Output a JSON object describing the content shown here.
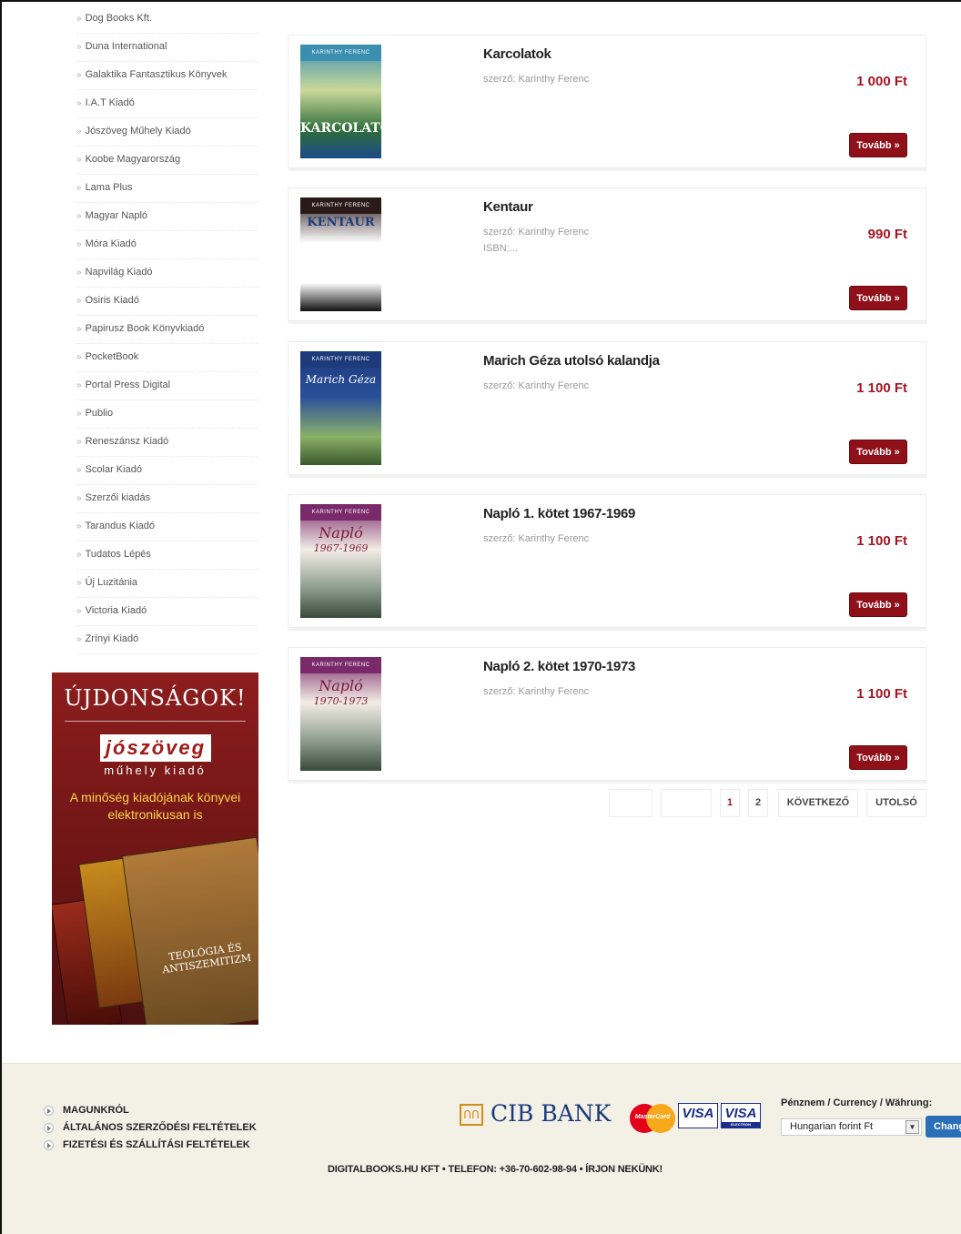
{
  "sidebar": {
    "publishers": [
      "Dog Books Kft.",
      "Duna International",
      "Galaktika Fantasztikus Könyvek",
      "I.A.T Kiadó",
      "Jószöveg Műhely Kiadó",
      "Koobe Magyarország",
      "Lama Plus",
      "Magyar Napló",
      "Móra Kiadó",
      "Napvilág Kiadó",
      "Osiris Kiadó",
      "Papirusz Book Könyvkiadó",
      "PocketBook",
      "Portal Press Digital",
      "Publio",
      "Reneszánsz Kiadó",
      "Scolar Kiadó",
      "Szerzői kiadás",
      "Tarandus Kiadó",
      "Tudatos Lépés",
      "Új Luzitánia",
      "Victoria Kiadó",
      "Zrínyi Kiadó"
    ],
    "arrow_glyph": "»"
  },
  "banner": {
    "title": "ÚJDONSÁGOK!",
    "logo": "jószöveg",
    "logo_sub": "műhely kiadó",
    "text": "A minőség kiadójának könyvei elektronikusan is",
    "book_text": "TEOLÓGIA ÉS ANTISZEMITIZM"
  },
  "products": [
    {
      "title": "Karcolatok",
      "author": "szerző: Karinthy Ferenc",
      "isbn": "",
      "price": "1 000 Ft",
      "more": "Tovább »",
      "cover_author": "KARINTHY FERENC",
      "cover_title": "KARCOLATOK",
      "cover_colors": [
        "#3a8fb0",
        "#c9d99a",
        "#2f6e3a",
        "#1c4a8a"
      ]
    },
    {
      "title": "Kentaur",
      "author": "szerző: Karinthy Ferenc",
      "isbn": "ISBN:...",
      "price": "990 Ft",
      "more": "Tovább »",
      "cover_author": "KARINTHY FERENC",
      "cover_title": "KENTAUR",
      "cover_colors": [
        "#2b1a1a",
        "#ffffff",
        "#ffffff",
        "#111111"
      ]
    },
    {
      "title": "Marich Géza utolsó kalandja",
      "author": "szerző: Karinthy Ferenc",
      "isbn": "",
      "price": "1 100 Ft",
      "more": "Tovább »",
      "cover_author": "KARINTHY FERENC",
      "cover_title": "Marich Géza",
      "cover_colors": [
        "#1d3a7a",
        "#2a4f9a",
        "#8ab06a",
        "#3a5a2a"
      ]
    },
    {
      "title": "Napló 1. kötet 1967-1969",
      "author": "szerző: Karinthy Ferenc",
      "isbn": "",
      "price": "1 100 Ft",
      "more": "Tovább »",
      "cover_author": "KARINTHY FERENC",
      "cover_title": "Napló",
      "cover_years": "1967-1969",
      "cover_colors": [
        "#7a2a6a",
        "#f3ede6",
        "#8a9a8a",
        "#3a4a3a"
      ]
    },
    {
      "title": "Napló 2. kötet 1970-1973",
      "author": "szerző: Karinthy Ferenc",
      "isbn": "",
      "price": "1 100 Ft",
      "more": "Tovább »",
      "cover_author": "KARINTHY FERENC",
      "cover_title": "Napló",
      "cover_years": "1970-1973",
      "cover_colors": [
        "#7a2a6a",
        "#f3ede6",
        "#8a9a8a",
        "#3a4a3a"
      ]
    }
  ],
  "pagination": {
    "pages": [
      "1",
      "2"
    ],
    "current": "1",
    "next": "KÖVETKEZŐ",
    "last": "UTOLSÓ"
  },
  "footer": {
    "links": [
      "MAGUNKRÓL",
      "ÁLTALÁNOS SZERZŐDÉSI FELTÉTELEK",
      "FIZETÉSI ÉS SZÁLLÍTÁSI FELTÉTELEK"
    ],
    "bank": "CIB BANK",
    "card_mastercard": "MasterCard",
    "card_visa": "VISA",
    "card_visa_electron": "VISA",
    "card_visa_electron_sub": "ELECTRON",
    "currency_label": "Pénznem / Currency / Währung:",
    "currency_value": "Hungarian forint Ft",
    "change_button": "Change",
    "contact": "DIGITALBOOKS.HU KFT • TELEFON: +36-70-602-98-94 • ÍRJON NEKÜNK!"
  },
  "colors": {
    "accent": "#a01622",
    "button": "#8f1018",
    "footer_bg": "#f3f0e6"
  }
}
